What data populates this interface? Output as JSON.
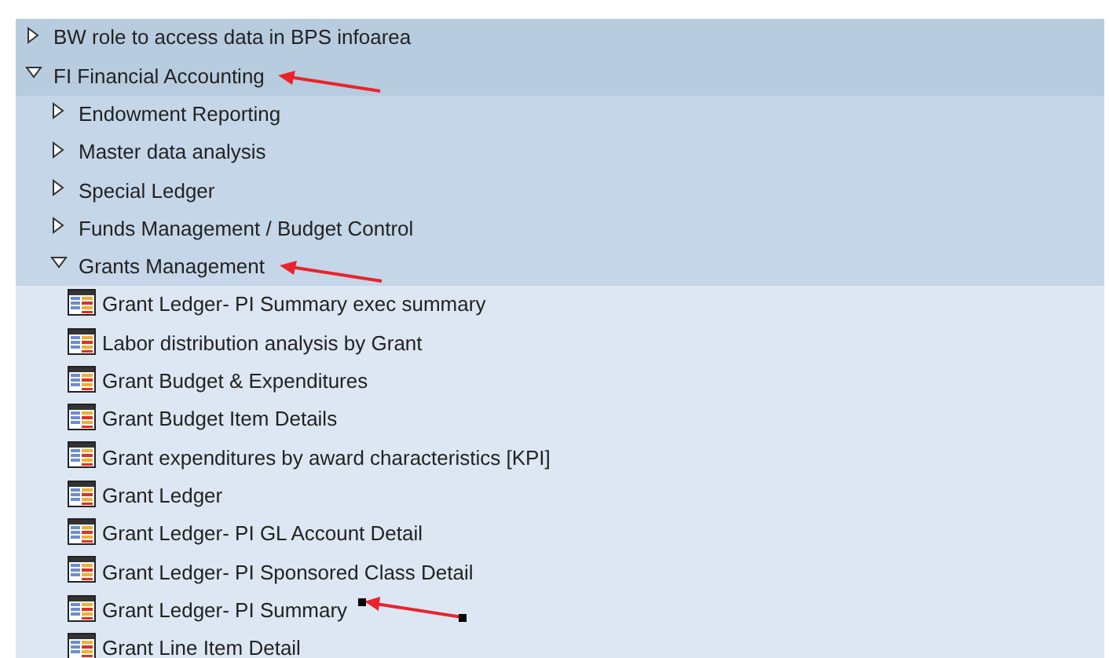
{
  "tree": [
    {
      "label": "BW role to access data in BPS infoarea",
      "expanded": false,
      "arrow": false,
      "handles": false
    },
    {
      "label": "FI Financial Accounting",
      "expanded": true,
      "arrow": true,
      "handles": false,
      "children": [
        {
          "label": "Endowment Reporting",
          "expanded": false,
          "arrow": false,
          "handles": false
        },
        {
          "label": "Master data analysis",
          "expanded": false,
          "arrow": false,
          "handles": false
        },
        {
          "label": "Special Ledger",
          "expanded": false,
          "arrow": false,
          "handles": false
        },
        {
          "label": "Funds Management / Budget Control",
          "expanded": false,
          "arrow": false,
          "handles": false
        },
        {
          "label": "Grants Management",
          "expanded": true,
          "arrow": true,
          "handles": false,
          "children": [
            {
              "kind": "report",
              "label": "Grant Ledger- PI Summary exec summary",
              "arrow": false,
              "handles": false
            },
            {
              "kind": "report",
              "label": "Labor distribution analysis by Grant",
              "arrow": false,
              "handles": false
            },
            {
              "kind": "report",
              "label": "Grant Budget & Expenditures",
              "arrow": false,
              "handles": false
            },
            {
              "kind": "report",
              "label": "Grant Budget Item Details",
              "arrow": false,
              "handles": false
            },
            {
              "kind": "report",
              "label": "Grant expenditures by award characteristics [KPI]",
              "arrow": false,
              "handles": false
            },
            {
              "kind": "report",
              "label": "Grant Ledger",
              "arrow": false,
              "handles": false
            },
            {
              "kind": "report",
              "label": "Grant Ledger- PI GL Account Detail",
              "arrow": false,
              "handles": false
            },
            {
              "kind": "report",
              "label": "Grant Ledger- PI Sponsored Class Detail",
              "arrow": false,
              "handles": false
            },
            {
              "kind": "report",
              "label": "Grant Ledger- PI Summary",
              "arrow": true,
              "handles": true
            },
            {
              "kind": "report",
              "label": "Grant Line Item Detail",
              "arrow": false,
              "handles": false
            }
          ]
        }
      ]
    }
  ]
}
